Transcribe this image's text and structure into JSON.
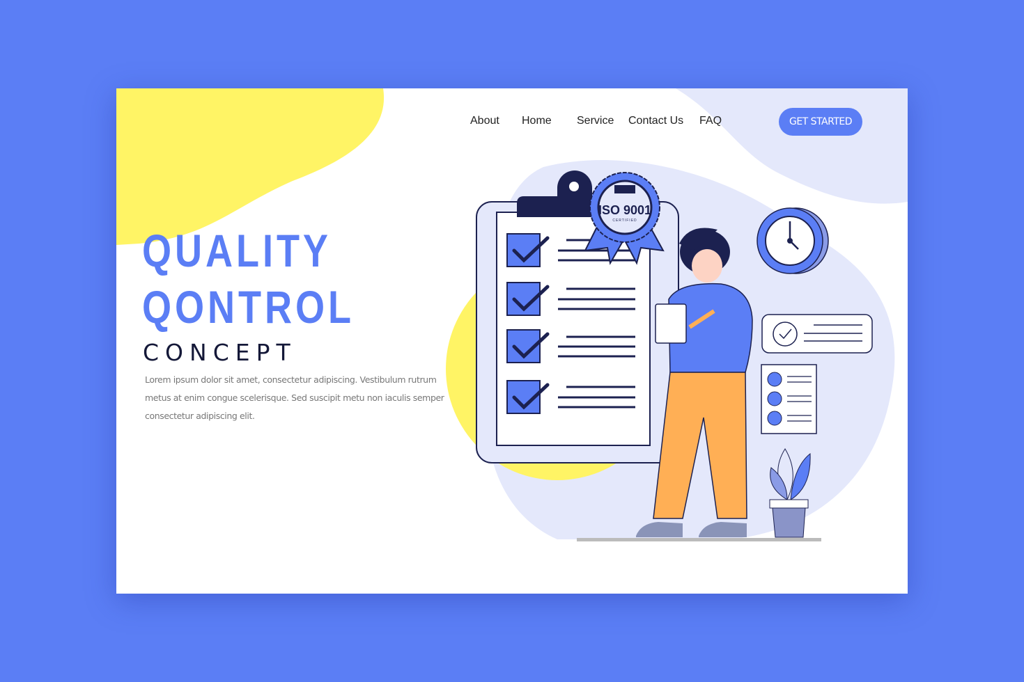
{
  "colors": {
    "background": "#5b7ef5",
    "accent": "#5b7ef5",
    "yellow": "#fff465",
    "lavender": "#e4e8fb",
    "navy": "#1c2150",
    "orange": "#ffaf55"
  },
  "nav": {
    "items": [
      {
        "label": "About"
      },
      {
        "label": "Home"
      },
      {
        "label": "Service"
      },
      {
        "label": "Contact Us"
      },
      {
        "label": "FAQ"
      }
    ],
    "cta_label": "GET STARTED"
  },
  "hero": {
    "title_line1": "QUALITY",
    "title_line2": "QONTROL",
    "subtitle": "CONCEPT",
    "body": "Lorem ipsum dolor sit amet, consectetur adipiscing. Vestibulum rutrum metus at enim congue scelerisque. Sed suscipit metu non iaculis semper consectetur adipiscing elit."
  },
  "badge": {
    "title": "ISO 9001",
    "caption": "CERTIFIED"
  }
}
